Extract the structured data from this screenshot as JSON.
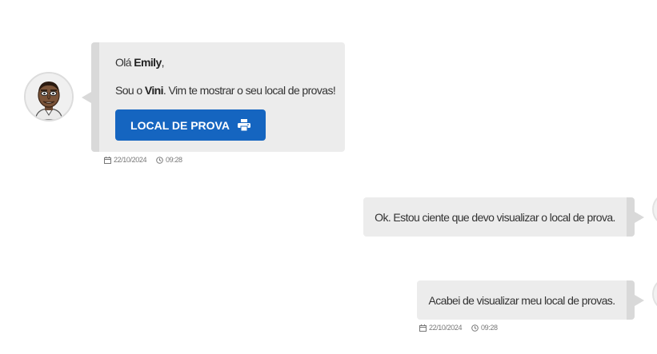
{
  "bot_message": {
    "greeting_prefix": "Olá ",
    "user_name": "Emily",
    "greeting_suffix": ",",
    "intro_prefix": "Sou o ",
    "bot_name": "Vini",
    "intro_suffix": ". Vim te mostrar o seu local de provas!",
    "button_label": "LOCAL DE PROVA",
    "button_icon": "printer-icon",
    "date": "22/10/2024",
    "time": "09:28"
  },
  "user_messages": [
    {
      "text": "Ok. Estou ciente que devo visualizar o local de prova."
    },
    {
      "text": "Acabei de visualizar meu local de provas.",
      "date": "22/10/2024",
      "time": "09:28"
    }
  ],
  "colors": {
    "bubble": "#ececec",
    "bubble_edge": "#d9d9d9",
    "button": "#1565c0",
    "meta_text": "#777777"
  }
}
